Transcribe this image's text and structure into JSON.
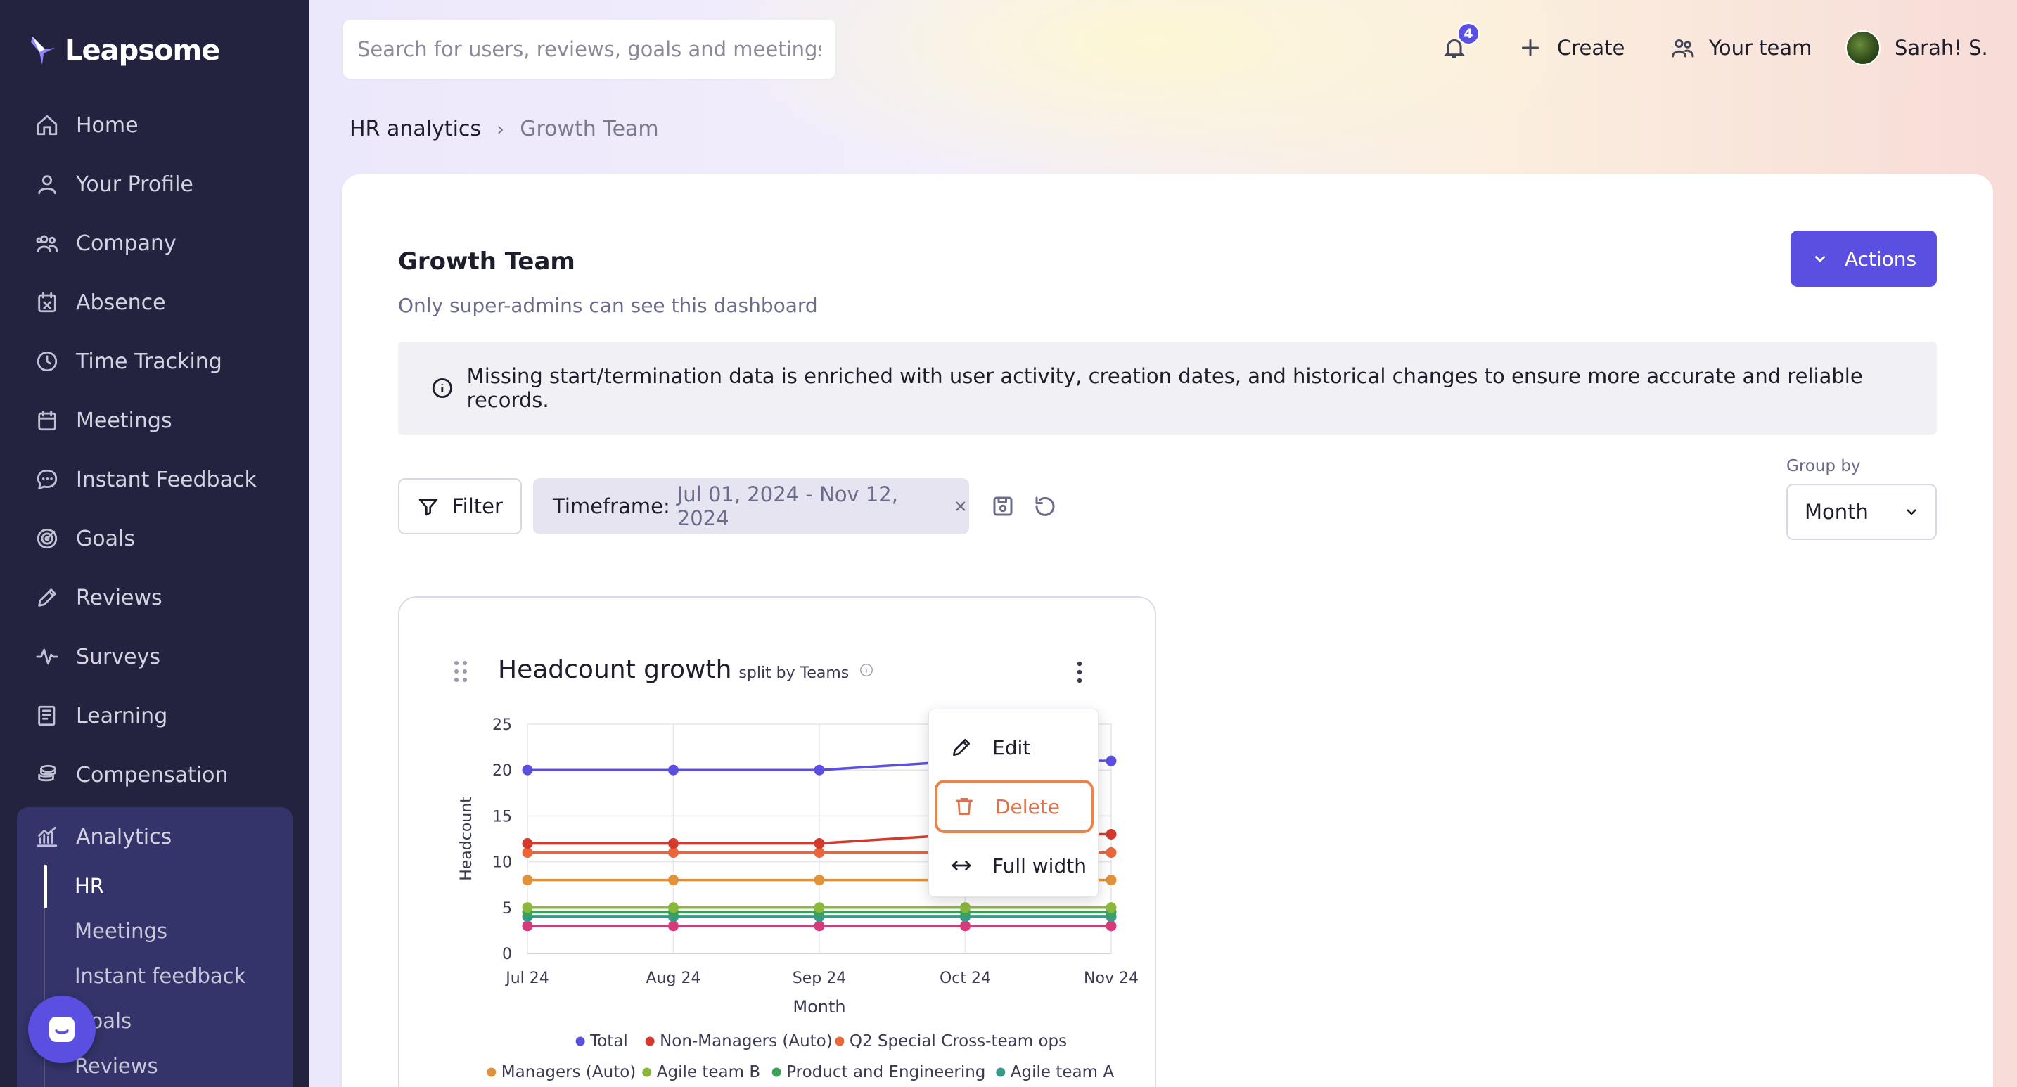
{
  "app": {
    "name": "Leapsome"
  },
  "sidebar": {
    "items": [
      {
        "label": "Home",
        "icon": "home-icon"
      },
      {
        "label": "Your Profile",
        "icon": "user-icon"
      },
      {
        "label": "Company",
        "icon": "company-icon"
      },
      {
        "label": "Absence",
        "icon": "calendar-x-icon"
      },
      {
        "label": "Time Tracking",
        "icon": "clock-icon"
      },
      {
        "label": "Meetings",
        "icon": "calendar-icon"
      },
      {
        "label": "Instant Feedback",
        "icon": "chat-icon"
      },
      {
        "label": "Goals",
        "icon": "target-icon"
      },
      {
        "label": "Reviews",
        "icon": "pencil-icon"
      },
      {
        "label": "Surveys",
        "icon": "pulse-icon"
      },
      {
        "label": "Learning",
        "icon": "book-icon"
      },
      {
        "label": "Compensation",
        "icon": "coins-icon"
      }
    ],
    "analytics": {
      "label": "Analytics",
      "icon": "analytics-icon",
      "sub_items": [
        "HR",
        "Meetings",
        "Instant feedback",
        "Goals",
        "Reviews"
      ],
      "active": "HR"
    }
  },
  "topbar": {
    "search_placeholder": "Search for users, reviews, goals and meetings",
    "notifications_count": "4",
    "create_label": "Create",
    "your_team_label": "Your team",
    "user_name": "Sarah! S."
  },
  "breadcrumb": {
    "parent": "HR analytics",
    "current": "Growth Team"
  },
  "page": {
    "title": "Growth Team",
    "subtitle": "Only super-admins can see this dashboard",
    "actions_label": "Actions",
    "info_banner": "Missing start/termination data is enriched with user activity, creation dates, and historical changes to ensure more accurate and reliable records.",
    "filter_label": "Filter",
    "timeframe_label": "Timeframe:",
    "timeframe_value": "Jul 01, 2024 - Nov 12, 2024",
    "group_by_label": "Group by",
    "group_by_value": "Month"
  },
  "widget": {
    "title": "Headcount growth",
    "subtitle": "split by Teams",
    "menu": {
      "edit": "Edit",
      "delete": "Delete",
      "full_width": "Full width"
    }
  },
  "chart_data": {
    "type": "line",
    "title": "Headcount growth",
    "xlabel": "Month",
    "ylabel": "Headcount",
    "ylim": [
      0,
      25
    ],
    "yticks": [
      0,
      5,
      10,
      15,
      20,
      25
    ],
    "categories": [
      "Jul 24",
      "Aug 24",
      "Sep 24",
      "Oct 24",
      "Nov 24"
    ],
    "grid": true,
    "legend_position": "bottom",
    "series": [
      {
        "name": "Total",
        "color": "#5b4fe0",
        "values": [
          20,
          20,
          20,
          21,
          21
        ]
      },
      {
        "name": "Non-Managers (Auto)",
        "color": "#d23a2e",
        "values": [
          12,
          12,
          12,
          13,
          13
        ]
      },
      {
        "name": "Q2 Special Cross-team ops",
        "color": "#e8663a",
        "values": [
          11,
          11,
          11,
          11,
          11
        ]
      },
      {
        "name": "Managers (Auto)",
        "color": "#e0923a",
        "values": [
          8,
          8,
          8,
          8,
          8
        ]
      },
      {
        "name": "Agile team B",
        "color": "#8ab83a",
        "values": [
          5,
          5,
          5,
          5,
          5
        ]
      },
      {
        "name": "Product and Engineering",
        "color": "#3aa05a",
        "values": [
          4.5,
          4.5,
          4.5,
          4.5,
          4.5
        ]
      },
      {
        "name": "Agile team A",
        "color": "#3a9a8a",
        "values": [
          4,
          4,
          4,
          4,
          4
        ]
      },
      {
        "name": "",
        "color": "#d63a7a",
        "values": [
          3,
          3,
          3,
          3,
          3
        ]
      }
    ]
  }
}
